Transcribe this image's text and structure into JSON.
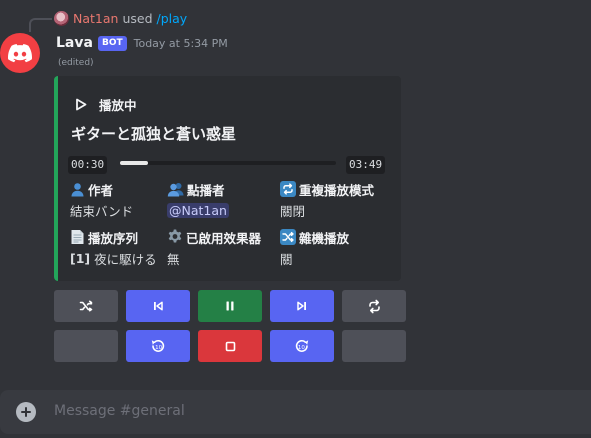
{
  "reply": {
    "username": "Nat1an",
    "action": "used",
    "command": "/play"
  },
  "message": {
    "username": "Lava",
    "bot_tag": "BOT",
    "timestamp": "Today at 5:34 PM",
    "edited": "(edited)"
  },
  "embed": {
    "accent_color": "#23a55a",
    "author": "播放中",
    "title": "ギターと孤独と蒼い惑星",
    "progress": {
      "current": "00:30",
      "total": "03:49",
      "fraction": 0.13
    },
    "fields": [
      {
        "icon": "person-icon",
        "name": "作者",
        "value": "結束バンド"
      },
      {
        "icon": "people-icon",
        "name": "點播者",
        "value": "@Nat1an"
      },
      {
        "icon": "repeat-icon",
        "name": "重複播放模式",
        "value": "關閉"
      },
      {
        "icon": "page-icon",
        "name": "播放序列",
        "value_prefix": "[1]",
        "value": "夜に駆ける"
      },
      {
        "icon": "gear-icon",
        "name": "已啟用效果器",
        "value": "無"
      },
      {
        "icon": "shuffle-icon",
        "name": "雜機播放",
        "value": "關"
      }
    ]
  },
  "buttons": [
    {
      "name": "shuffle-button",
      "icon": "shuffle-icon",
      "style": "grey"
    },
    {
      "name": "previous-button",
      "icon": "skip-previous-icon",
      "style": "blue"
    },
    {
      "name": "pause-button",
      "icon": "pause-icon",
      "style": "green"
    },
    {
      "name": "next-button",
      "icon": "skip-next-icon",
      "style": "blue"
    },
    {
      "name": "loop-button",
      "icon": "loop-icon",
      "style": "grey"
    },
    {
      "name": "blank-button-left",
      "icon": "",
      "style": "grey"
    },
    {
      "name": "rewind-button",
      "icon": "rewind-10-icon",
      "style": "blue"
    },
    {
      "name": "stop-button",
      "icon": "stop-icon",
      "style": "red"
    },
    {
      "name": "forward-button",
      "icon": "forward-10-icon",
      "style": "blue"
    },
    {
      "name": "blank-button-right",
      "icon": "",
      "style": "grey"
    }
  ],
  "composer": {
    "placeholder": "Message #general"
  }
}
